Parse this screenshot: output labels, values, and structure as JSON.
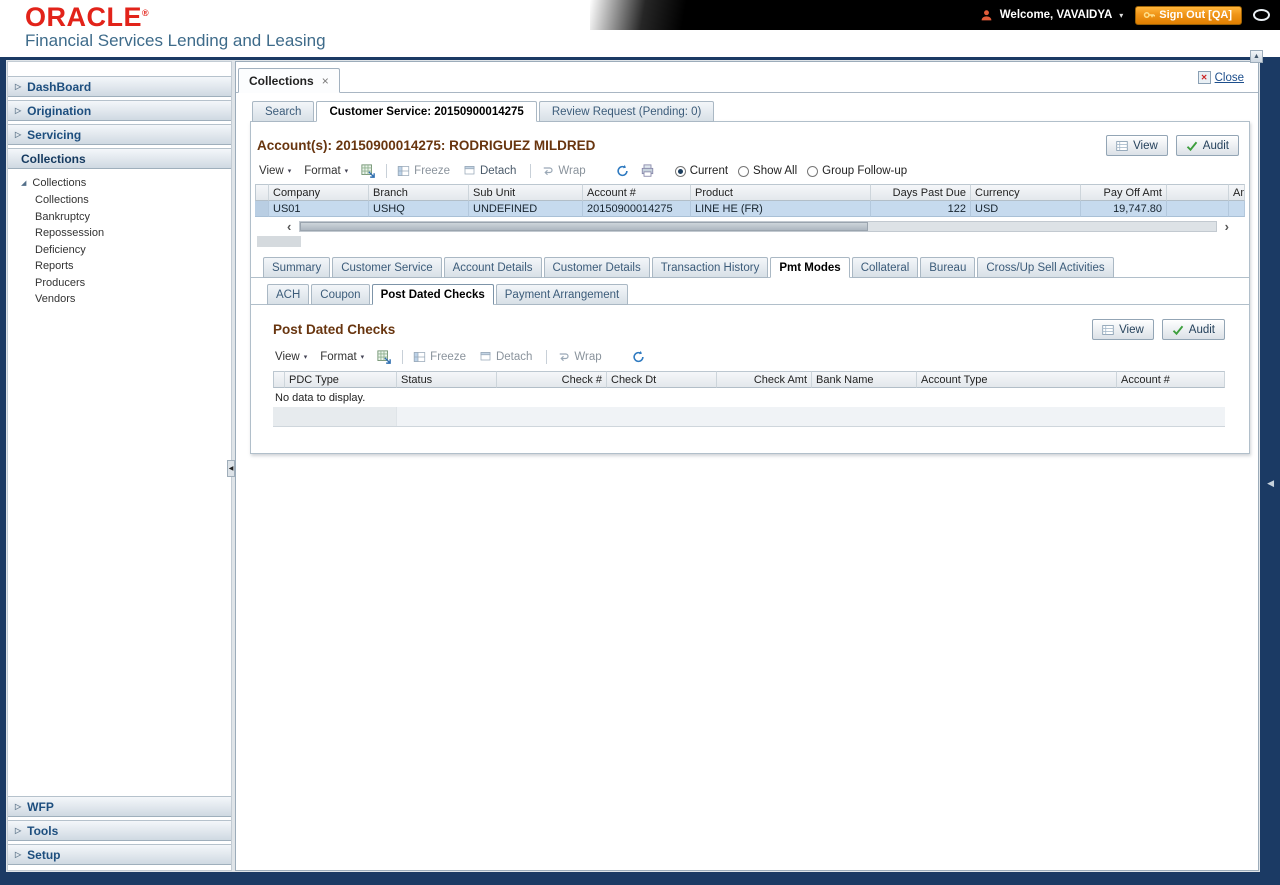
{
  "labels": {
    "view": "View",
    "audit": "Audit",
    "close": "Close"
  },
  "icons": {
    "chevron": "▷",
    "tree_expanded": "◢",
    "dropdown": "▾",
    "tab_close": "×",
    "close_x": "✕",
    "scroll_left": "‹",
    "scroll_right": "›",
    "scroll_up": "▲",
    "collapse_left": "◀",
    "welcome_caret": "▾"
  },
  "colors": {
    "oracle_red": "#e2231a",
    "frame_navy": "#1b3a64",
    "section_heading_brown": "#68350f",
    "selected_row_blue": "#c6daee",
    "sign_out_orange": "#ef9418",
    "audit_check_green": "#3c9e3c"
  },
  "header": {
    "logo": "ORACLE",
    "registered": "®",
    "subtitle": "Financial Services Lending and Leasing",
    "welcome": "Welcome, VAVAIDYA",
    "sign_out": "Sign Out [QA]"
  },
  "sidebar": {
    "top_sections": [
      {
        "label": "DashBoard"
      },
      {
        "label": "Origination"
      },
      {
        "label": "Servicing"
      },
      {
        "label": "Collections"
      }
    ],
    "tree": {
      "root": "Collections",
      "items": [
        {
          "label": "Collections"
        },
        {
          "label": "Bankruptcy"
        },
        {
          "label": "Repossession"
        },
        {
          "label": "Deficiency"
        },
        {
          "label": "Reports"
        },
        {
          "label": "Producers"
        },
        {
          "label": "Vendors"
        }
      ]
    },
    "bottom_sections": [
      {
        "label": "WFP"
      },
      {
        "label": "Tools"
      },
      {
        "label": "Setup"
      }
    ]
  },
  "workspace": {
    "tab": "Collections",
    "tabs": [
      {
        "label": "Search"
      },
      {
        "label": "Customer Service: 20150900014275"
      },
      {
        "label": "Review Request (Pending: 0)"
      }
    ]
  },
  "account": {
    "title": "Account(s): 20150900014275: RODRIGUEZ MILDRED",
    "toolbar": {
      "view": "View",
      "format": "Format",
      "freeze": "Freeze",
      "detach": "Detach",
      "wrap": "Wrap",
      "radios": [
        {
          "label": "Current",
          "selected": true
        },
        {
          "label": "Show All",
          "selected": false
        },
        {
          "label": "Group Follow-up",
          "selected": false
        }
      ]
    },
    "table": {
      "columns": [
        {
          "label": "Company"
        },
        {
          "label": "Branch"
        },
        {
          "label": "Sub Unit"
        },
        {
          "label": "Account #"
        },
        {
          "label": "Product"
        },
        {
          "label": "Days Past Due"
        },
        {
          "label": "Currency"
        },
        {
          "label": "Pay Off Amt"
        },
        {
          "label": "Am"
        }
      ],
      "row": {
        "company": "US01",
        "branch": "USHQ",
        "sub_unit": "UNDEFINED",
        "account": "20150900014275",
        "product": "LINE HE (FR)",
        "days_past_due": "122",
        "currency": "USD",
        "pay_off_amt": "19,747.80"
      }
    }
  },
  "detail_tabs": [
    {
      "label": "Summary"
    },
    {
      "label": "Customer Service"
    },
    {
      "label": "Account Details"
    },
    {
      "label": "Customer Details"
    },
    {
      "label": "Transaction History"
    },
    {
      "label": "Pmt Modes"
    },
    {
      "label": "Collateral"
    },
    {
      "label": "Bureau"
    },
    {
      "label": "Cross/Up Sell Activities"
    }
  ],
  "pmt_tabs": [
    {
      "label": "ACH"
    },
    {
      "label": "Coupon"
    },
    {
      "label": "Post Dated Checks"
    },
    {
      "label": "Payment Arrangement"
    }
  ],
  "pdc": {
    "title": "Post Dated Checks",
    "toolbar": {
      "view": "View",
      "format": "Format",
      "freeze": "Freeze",
      "detach": "Detach",
      "wrap": "Wrap"
    },
    "columns": [
      {
        "label": "PDC Type"
      },
      {
        "label": "Status"
      },
      {
        "label": "Check #"
      },
      {
        "label": "Check Dt"
      },
      {
        "label": "Check Amt"
      },
      {
        "label": "Bank Name"
      },
      {
        "label": "Account Type"
      },
      {
        "label": "Account #"
      }
    ],
    "empty_text": "No data to display."
  }
}
